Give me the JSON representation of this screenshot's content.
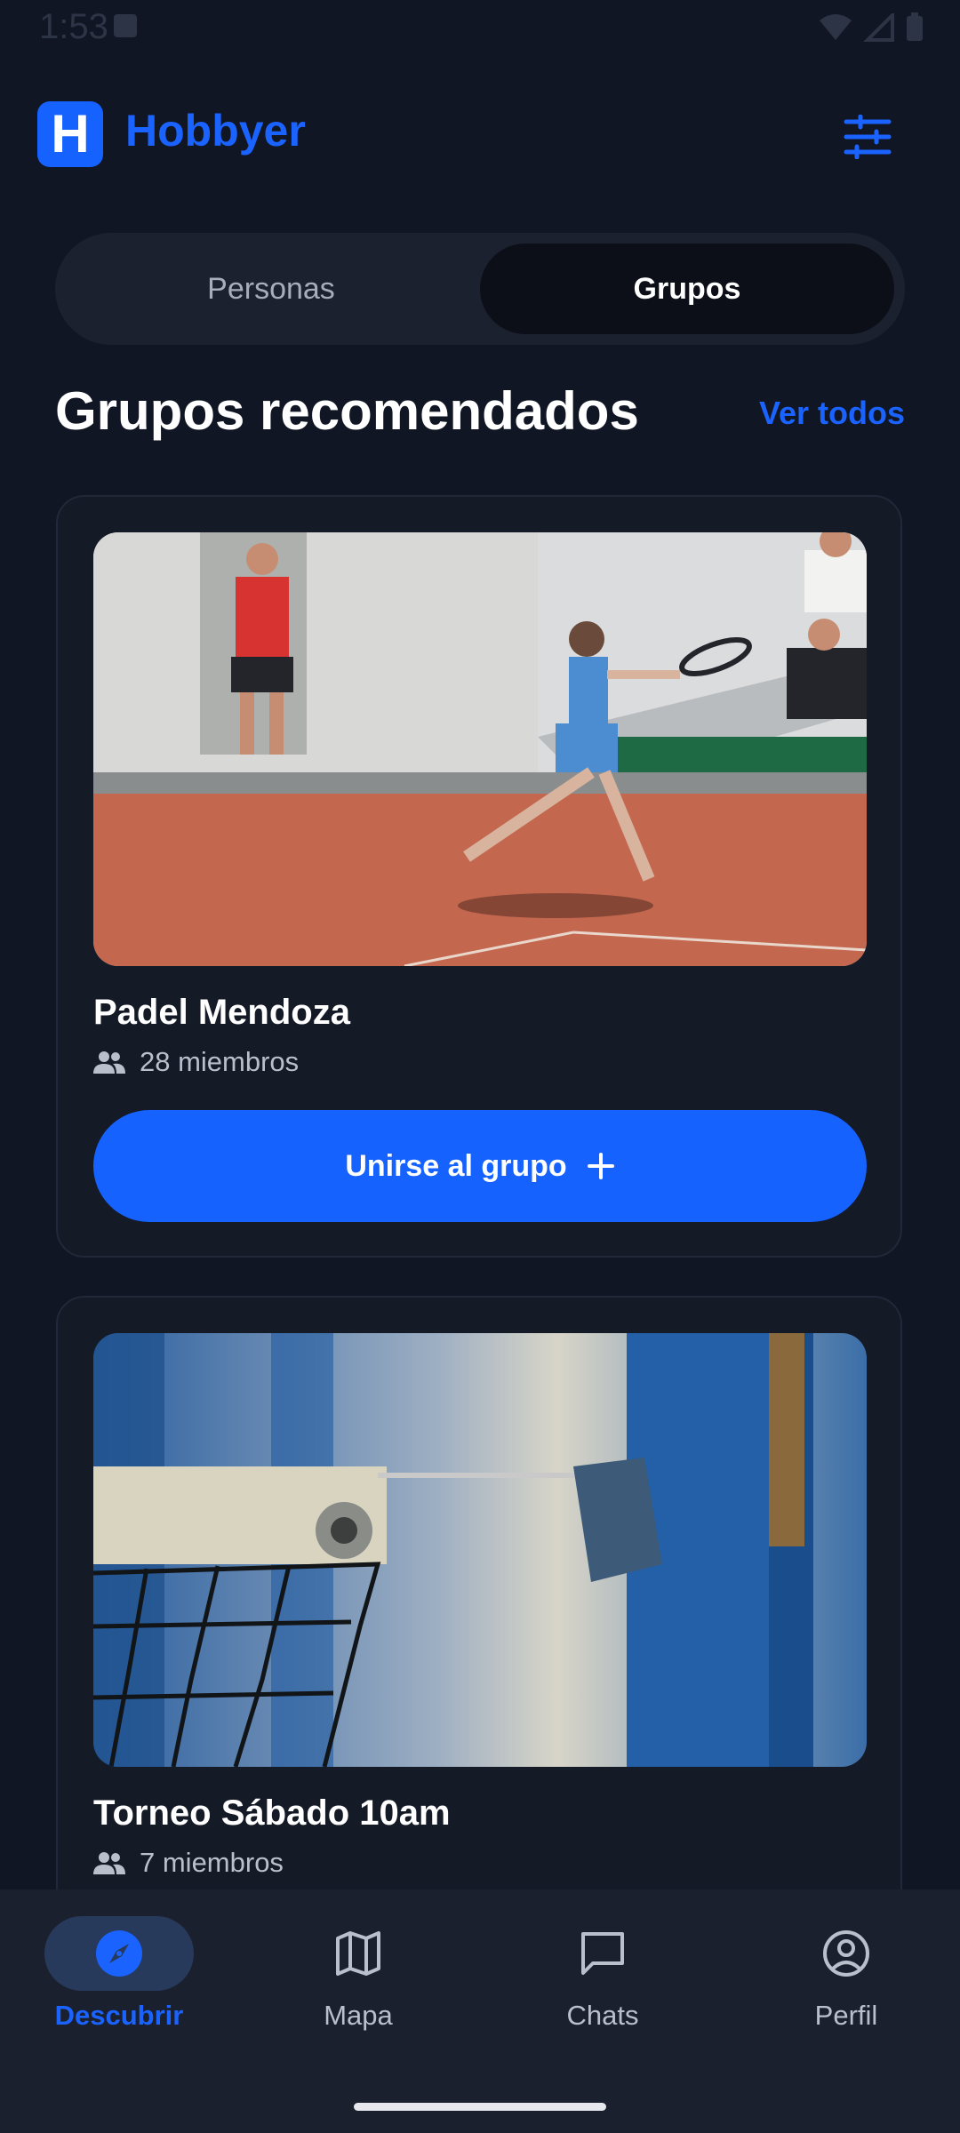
{
  "status_bar": {
    "time": "1:53"
  },
  "header": {
    "app_name": "Hobbyer",
    "logo_letter": "H",
    "filter_icon": "tune-icon"
  },
  "segment": {
    "options": [
      "Personas",
      "Grupos"
    ],
    "selected": "Grupos"
  },
  "section": {
    "title": "Grupos recomendados",
    "see_all": "Ver todos"
  },
  "groups": [
    {
      "name": "Padel Mendoza",
      "members": "28 miembros",
      "join_label": "Unirse al grupo",
      "photo": "tennis-player-clay-court"
    },
    {
      "name": "Torneo Sábado 10am",
      "members": "7 miembros",
      "photo": "padel-net-closeup"
    }
  ],
  "bottom_nav": {
    "items": [
      {
        "label": "Descubrir",
        "icon": "compass-icon"
      },
      {
        "label": "Mapa",
        "icon": "map-icon"
      },
      {
        "label": "Chats",
        "icon": "chat-icon"
      },
      {
        "label": "Perfil",
        "icon": "profile-icon"
      }
    ],
    "active": "Descubrir"
  },
  "colors": {
    "accent": "#1562ff",
    "background": "#111624",
    "card": "#151a27"
  }
}
